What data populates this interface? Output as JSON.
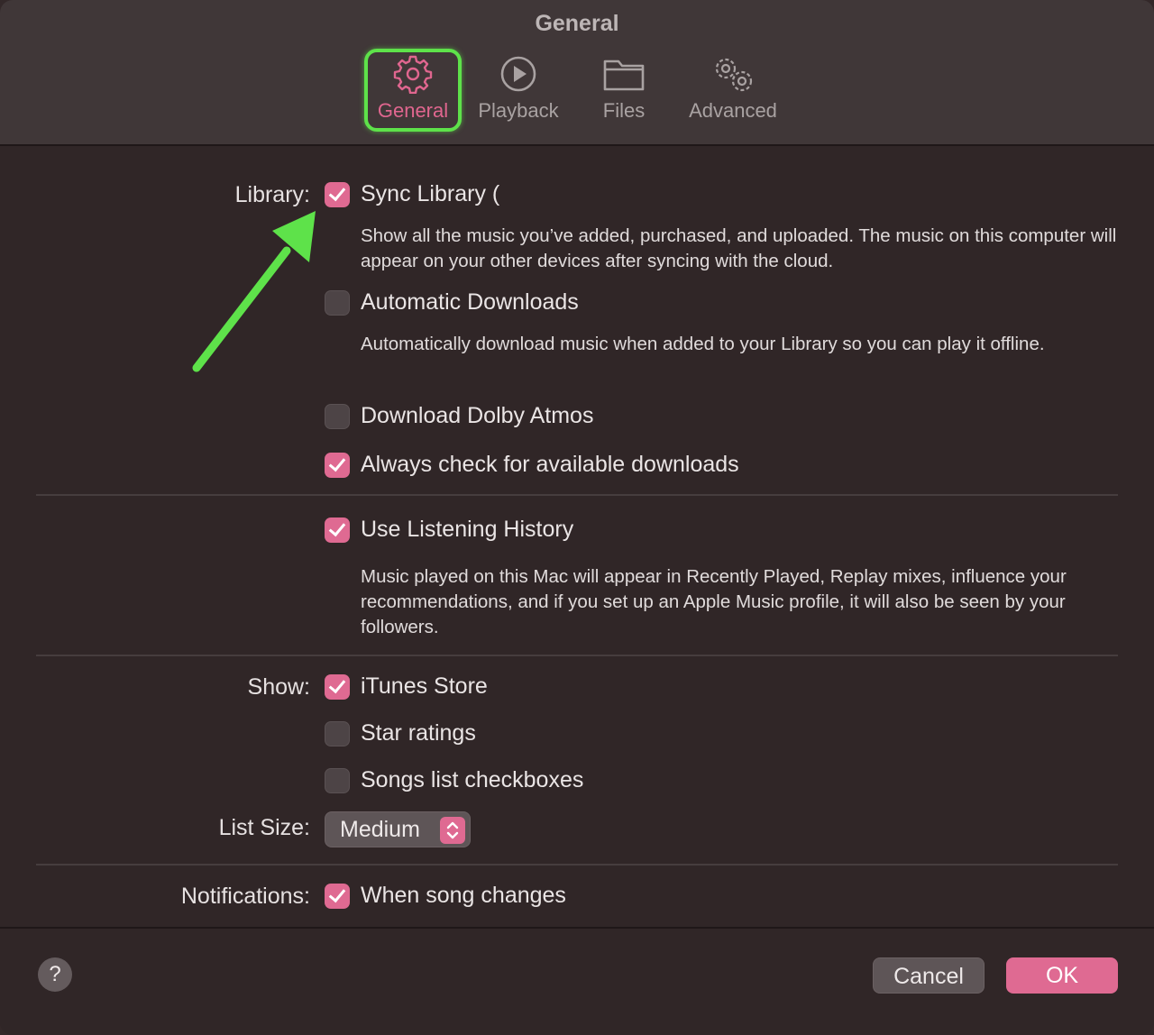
{
  "window": {
    "title": "General"
  },
  "tabs": [
    {
      "label": "General",
      "icon": "gear-icon",
      "selected": true
    },
    {
      "label": "Playback",
      "icon": "play-circle-icon",
      "selected": false
    },
    {
      "label": "Files",
      "icon": "folder-icon",
      "selected": false
    },
    {
      "label": "Advanced",
      "icon": "gears-icon",
      "selected": false
    }
  ],
  "library": {
    "label": "Library:",
    "sync": {
      "label": "Sync Library (",
      "checked": true,
      "desc": "Show all the music you’ve added, purchased, and uploaded. The music on this computer will appear on your other devices after syncing with the cloud."
    },
    "auto_downloads": {
      "label": "Automatic Downloads",
      "checked": false,
      "desc": "Automatically download music when added to your Library so you can play it offline."
    },
    "dolby": {
      "label": "Download Dolby Atmos",
      "checked": false
    },
    "always_check": {
      "label": "Always check for available downloads",
      "checked": true
    }
  },
  "listening": {
    "label": "Use Listening History",
    "checked": true,
    "desc": "Music played on this Mac will appear in Recently Played, Replay mixes, influence your recommendations, and if you set up an Apple Music profile, it will also be seen by your followers."
  },
  "show": {
    "label": "Show:",
    "itunes_store": {
      "label": "iTunes Store",
      "checked": true
    },
    "star_ratings": {
      "label": "Star ratings",
      "checked": false
    },
    "songs_checkboxes": {
      "label": "Songs list checkboxes",
      "checked": false
    }
  },
  "list_size": {
    "label": "List Size:",
    "value": "Medium"
  },
  "notifications": {
    "label": "Notifications:",
    "when_song_changes": {
      "label": "When song changes",
      "checked": true
    }
  },
  "footer": {
    "help": "?",
    "cancel": "Cancel",
    "ok": "OK"
  },
  "colors": {
    "accent": "#df6a92",
    "annotation": "#5ee24a",
    "background": "#302627"
  }
}
